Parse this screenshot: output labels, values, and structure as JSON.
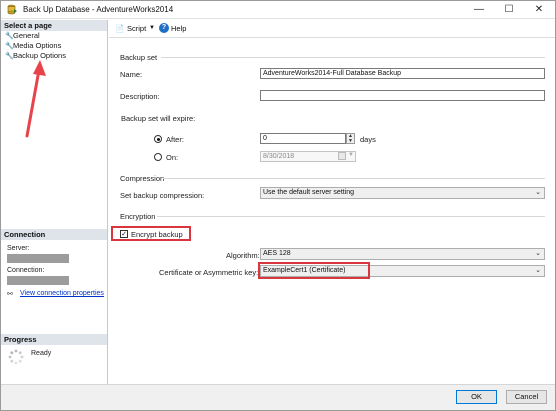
{
  "window": {
    "title": "Back Up Database - AdventureWorks2014",
    "minimize_glyph": "—",
    "maximize_glyph": "☐",
    "close_glyph": "✕"
  },
  "left_pane": {
    "select_page_header": "Select a page",
    "pages": [
      {
        "label": "General",
        "icon": "wrench-icon"
      },
      {
        "label": "Media Options",
        "icon": "wrench-icon"
      },
      {
        "label": "Backup Options",
        "icon": "wrench-icon"
      }
    ],
    "connection_header": "Connection",
    "server_label": "Server:",
    "connection_label": "Connection:",
    "view_connection_properties": "View connection properties",
    "progress_header": "Progress",
    "progress_status": "Ready"
  },
  "toolbar": {
    "script_label": "Script",
    "help_label": "Help"
  },
  "backup_set": {
    "group_title": "Backup set",
    "name_label": "Name:",
    "name_value": "AdventureWorks2014-Full Database Backup",
    "description_label": "Description:",
    "description_value": "",
    "expire_label": "Backup set will expire:",
    "after_label": "After:",
    "after_value": "0",
    "days_label": "days",
    "on_label": "On:",
    "on_value": "8/30/2018",
    "selected_expiry": "After"
  },
  "compression": {
    "group_title": "Compression",
    "label": "Set backup compression:",
    "value": "Use the default server setting"
  },
  "encryption": {
    "group_title": "Encryption",
    "encrypt_label": "Encrypt backup",
    "encrypt_checked": true,
    "algorithm_label": "Algorithm:",
    "algorithm_value": "AES 128",
    "certificate_label": "Certificate or Asymmetric key:",
    "certificate_value": "ExampleCert1 (Certificate)"
  },
  "buttons": {
    "ok": "OK",
    "cancel": "Cancel"
  },
  "colors": {
    "annotation_red": "#d9363e",
    "section_header_bg": "#dfe3ea",
    "link_blue": "#0033cc"
  }
}
